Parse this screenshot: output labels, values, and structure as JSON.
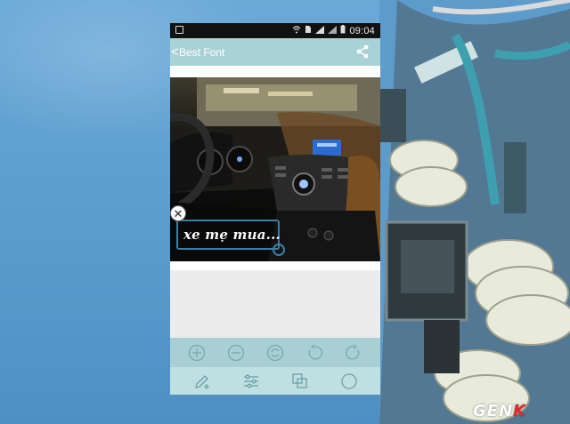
{
  "statusbar": {
    "time": "09:04",
    "icons": [
      "image-notification-icon",
      "wifi-icon",
      "sim-icon",
      "signal-icon",
      "signal-2-icon",
      "battery-icon"
    ]
  },
  "appbar": {
    "back_glyph": "<",
    "title": "Best Font",
    "share_icon": "share-icon"
  },
  "sticker": {
    "text": "xe mẹ mua...",
    "close_glyph": "✕",
    "frame_color": "#3a7fa6"
  },
  "toolbar_top": {
    "icons": [
      "zoom-in-icon",
      "zoom-out-icon",
      "rotate-reset-icon",
      "undo-rotate-icon",
      "redo-rotate-icon"
    ]
  },
  "toolbar_bottom": {
    "icons": [
      "add-text-icon",
      "adjust-settings-icon",
      "layers-icon",
      "shape-circle-icon"
    ]
  },
  "watermark": {
    "text_main": "GEN",
    "text_accent": "K"
  },
  "colors": {
    "appbar": "#a9d2d7",
    "toolbar_top": "#a7cfd4",
    "toolbar_bottom": "#bfe0e3",
    "sky": "#5b9ccd",
    "watermark_accent": "#e02a2a"
  }
}
